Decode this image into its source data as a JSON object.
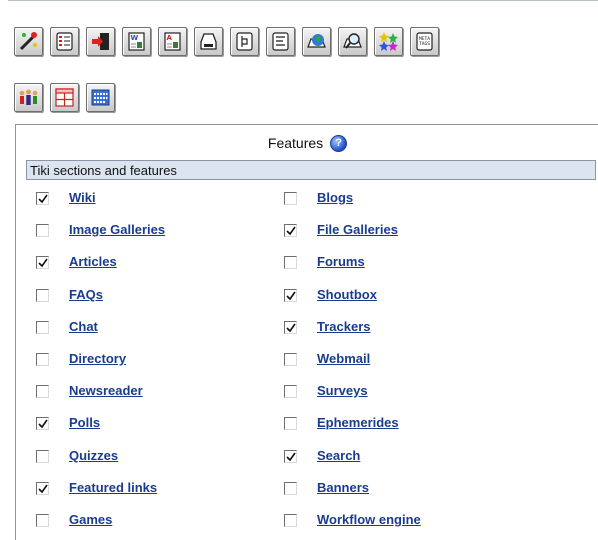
{
  "toolbar": {
    "icons": [
      "wand-icon",
      "list-icon",
      "login-icon",
      "wiki-icon",
      "articles-icon",
      "save-icon",
      "tracker-icon",
      "text-icon",
      "globe-icon",
      "search-icon",
      "stars-icon",
      "meta-tags-icon",
      "users-icon",
      "layout-icon",
      "calendar-icon"
    ],
    "meta_tags_text": "META TAGS"
  },
  "panel": {
    "title": "Features",
    "help_label": "?",
    "section_header": "Tiki sections and features"
  },
  "features": {
    "left": [
      {
        "label": "Wiki",
        "checked": true
      },
      {
        "label": "Image Galleries",
        "checked": false
      },
      {
        "label": "Articles",
        "checked": true
      },
      {
        "label": "FAQs",
        "checked": false
      },
      {
        "label": "Chat",
        "checked": false
      },
      {
        "label": "Directory",
        "checked": false
      },
      {
        "label": "Newsreader",
        "checked": false
      },
      {
        "label": "Polls",
        "checked": true
      },
      {
        "label": "Quizzes",
        "checked": false
      },
      {
        "label": "Featured links",
        "checked": true
      },
      {
        "label": "Games",
        "checked": false
      }
    ],
    "right": [
      {
        "label": "Blogs",
        "checked": false
      },
      {
        "label": "File Galleries",
        "checked": true
      },
      {
        "label": "Forums",
        "checked": false
      },
      {
        "label": "Shoutbox",
        "checked": true
      },
      {
        "label": "Trackers",
        "checked": true
      },
      {
        "label": "Webmail",
        "checked": false
      },
      {
        "label": "Surveys",
        "checked": false
      },
      {
        "label": "Ephemerides",
        "checked": false
      },
      {
        "label": "Search",
        "checked": true
      },
      {
        "label": "Banners",
        "checked": false
      },
      {
        "label": "Workflow engine",
        "checked": false
      }
    ]
  }
}
